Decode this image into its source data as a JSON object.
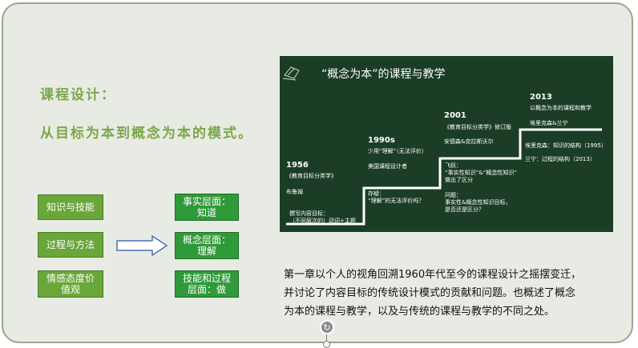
{
  "left": {
    "heading1": "课程设计：",
    "heading2": "从目标为本到概念为本的模式。"
  },
  "boxes_left": [
    "知识与技能",
    "过程与方法",
    "情感态度价\n值观"
  ],
  "boxes_right": [
    "事实层面：\n知道",
    "概念层面：\n理解",
    "技能和过程\n层面：做"
  ],
  "image": {
    "title": "“概念为本”的课程与教学",
    "y1956": "1956",
    "y1956_book": "《教育目标分类学》",
    "y1956_author": "布鲁姆",
    "y1956_note": "撰写内容目标：\n（不同层次的）动词+主题",
    "y1990": "1990s",
    "y1990_sub": "少用“理解”（无法评价）",
    "y1990_author": "美国课程设计者",
    "y1990_note": "存疑：\n“理解”的无法评价吗？",
    "y2001": "2001",
    "y2001_book": "《教育目标分类学》修订版",
    "y2001_author": "安德森&克拉斯沃尔",
    "y2001_note1": "飞跃：\n“事实性知识”&“概念性知识”\n做出了区分",
    "y2001_note2": "问题：\n事实性&概念性知识目标，\n是否还是区分？",
    "y2013": "2013",
    "y2013_book": "以概念为本的课程和教学",
    "y2013_author": "埃里克森&兰宁",
    "y2013_ref1": "埃里克森：知识的结构（1995）",
    "y2013_ref2": "兰宁：过程的结构（2013）"
  },
  "description": [
    "第一章以个人的视角回溯1960年代至今的课程设计之摇摆变迁，",
    "并讨论了内容目标的传统设计模式的贡献和问题。也概述了概念",
    "为本的课程与教学，以及与传统的课程与教学的不同之处。"
  ],
  "colors": {
    "slide_bg": "#e8ebe3",
    "heading": "#7aa84a",
    "left_box": "#6aa63a",
    "right_box": "#2f9a3a",
    "dark_panel": "#1b3d26"
  },
  "icons": [
    "book-icon",
    "rotate-icon",
    "arrow-right-icon"
  ]
}
